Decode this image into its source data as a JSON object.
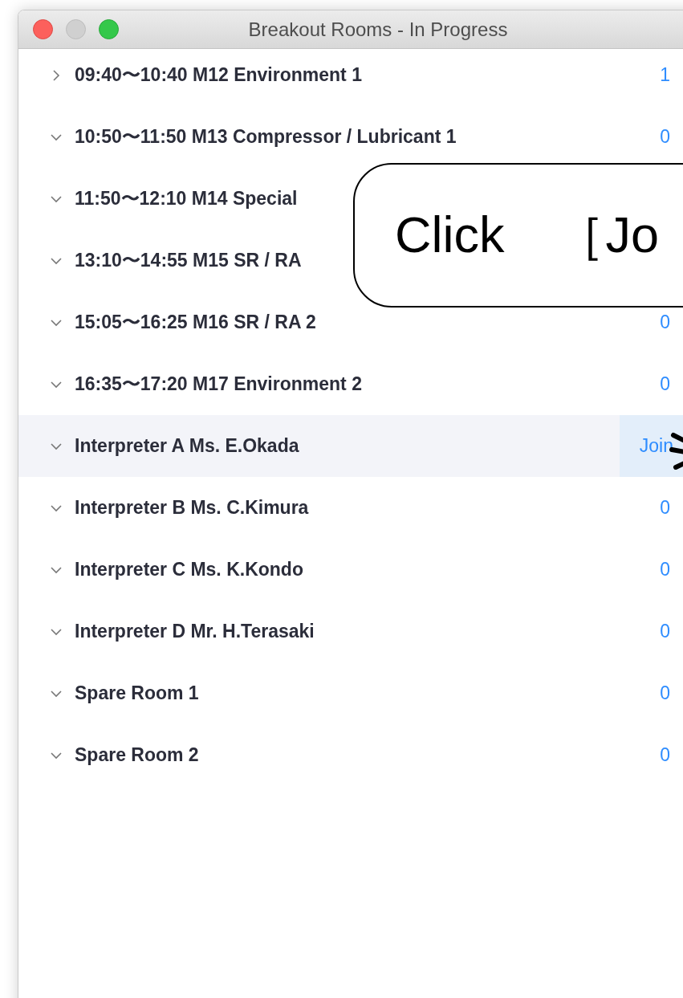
{
  "window": {
    "title": "Breakout Rooms - In Progress"
  },
  "rooms": [
    {
      "name": "09:40〜10:40 M12 Environment 1",
      "expanded": false,
      "hovered": false,
      "count": "1"
    },
    {
      "name": "10:50〜11:50 M13 Compressor / Lubricant 1",
      "expanded": true,
      "hovered": false,
      "count": "0"
    },
    {
      "name": "11:50〜12:10 M14 Special",
      "expanded": true,
      "hovered": false
    },
    {
      "name": "13:10〜14:55 M15 SR / RA",
      "expanded": true,
      "hovered": false
    },
    {
      "name": "15:05〜16:25 M16 SR / RA 2",
      "expanded": true,
      "hovered": false,
      "count": "0"
    },
    {
      "name": "16:35〜17:20 M17 Environment 2",
      "expanded": true,
      "hovered": false,
      "count": "0"
    },
    {
      "name": "Interpreter A  Ms. E.Okada",
      "expanded": true,
      "hovered": true,
      "action": "Join"
    },
    {
      "name": "Interpreter B  Ms. C.Kimura",
      "expanded": true,
      "hovered": false,
      "count": "0"
    },
    {
      "name": "Interpreter C  Ms. K.Kondo",
      "expanded": true,
      "hovered": false,
      "count": "0"
    },
    {
      "name": "Interpreter D Mr. H.Terasaki",
      "expanded": true,
      "hovered": false,
      "count": "0"
    },
    {
      "name": "Spare Room 1",
      "expanded": true,
      "hovered": false,
      "count": "0"
    },
    {
      "name": "Spare Room 2",
      "expanded": true,
      "hovered": false,
      "count": "0"
    }
  ],
  "callout": {
    "text": "Click　［Jo"
  }
}
